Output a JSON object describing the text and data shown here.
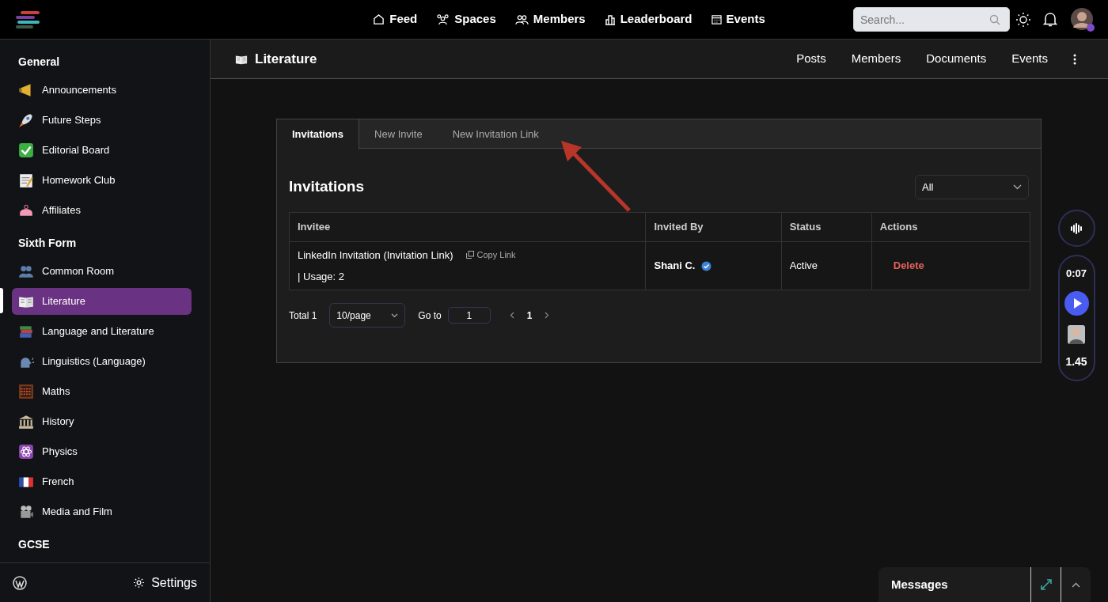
{
  "top_nav": [
    {
      "label": "Feed"
    },
    {
      "label": "Spaces"
    },
    {
      "label": "Members"
    },
    {
      "label": "Leaderboard"
    },
    {
      "label": "Events"
    }
  ],
  "search": {
    "placeholder": "Search..."
  },
  "sidebar": {
    "sections": [
      {
        "title": "General",
        "items": [
          {
            "label": "Announcements",
            "selected": false
          },
          {
            "label": "Future Steps",
            "selected": false
          },
          {
            "label": "Editorial Board",
            "selected": false
          },
          {
            "label": "Homework Club",
            "selected": false
          },
          {
            "label": "Affiliates",
            "selected": false
          }
        ]
      },
      {
        "title": "Sixth Form",
        "items": [
          {
            "label": "Common Room",
            "selected": false
          },
          {
            "label": "Literature",
            "selected": true
          },
          {
            "label": "Language and Literature",
            "selected": false
          },
          {
            "label": "Linguistics (Language)",
            "selected": false
          },
          {
            "label": "Maths",
            "selected": false
          },
          {
            "label": "History",
            "selected": false
          },
          {
            "label": "Physics",
            "selected": false
          },
          {
            "label": "French",
            "selected": false
          },
          {
            "label": "Media and Film",
            "selected": false
          }
        ]
      },
      {
        "title": "GCSE"
      }
    ],
    "settings": "Settings"
  },
  "space": {
    "title": "Literature",
    "tabs": [
      {
        "label": "Posts"
      },
      {
        "label": "Members"
      },
      {
        "label": "Documents"
      },
      {
        "label": "Events"
      }
    ]
  },
  "invitations": {
    "tabs": [
      {
        "label": "Invitations",
        "selected": true
      },
      {
        "label": "New Invite",
        "selected": false
      },
      {
        "label": "New Invitation Link",
        "selected": false
      }
    ],
    "heading": "Invitations",
    "filter": "All",
    "columns": [
      "Invitee",
      "Invited By",
      "Status",
      "Actions"
    ],
    "rows": [
      {
        "invitee": "LinkedIn Invitation (Invitation Link)",
        "copy": "Copy Link",
        "usage": "| Usage: 2",
        "invited_by": "Shani C.",
        "verified": true,
        "status": "Active",
        "action": "Delete"
      }
    ],
    "pagination": {
      "total": "Total 1",
      "page_size": "10/page",
      "goto_label": "Go to",
      "goto_value": "1",
      "pages": [
        {
          "label": "1",
          "selected": true
        }
      ]
    }
  },
  "audio_widget": {
    "time": "0:07",
    "rate": "1.45"
  },
  "messages": {
    "title": "Messages"
  }
}
